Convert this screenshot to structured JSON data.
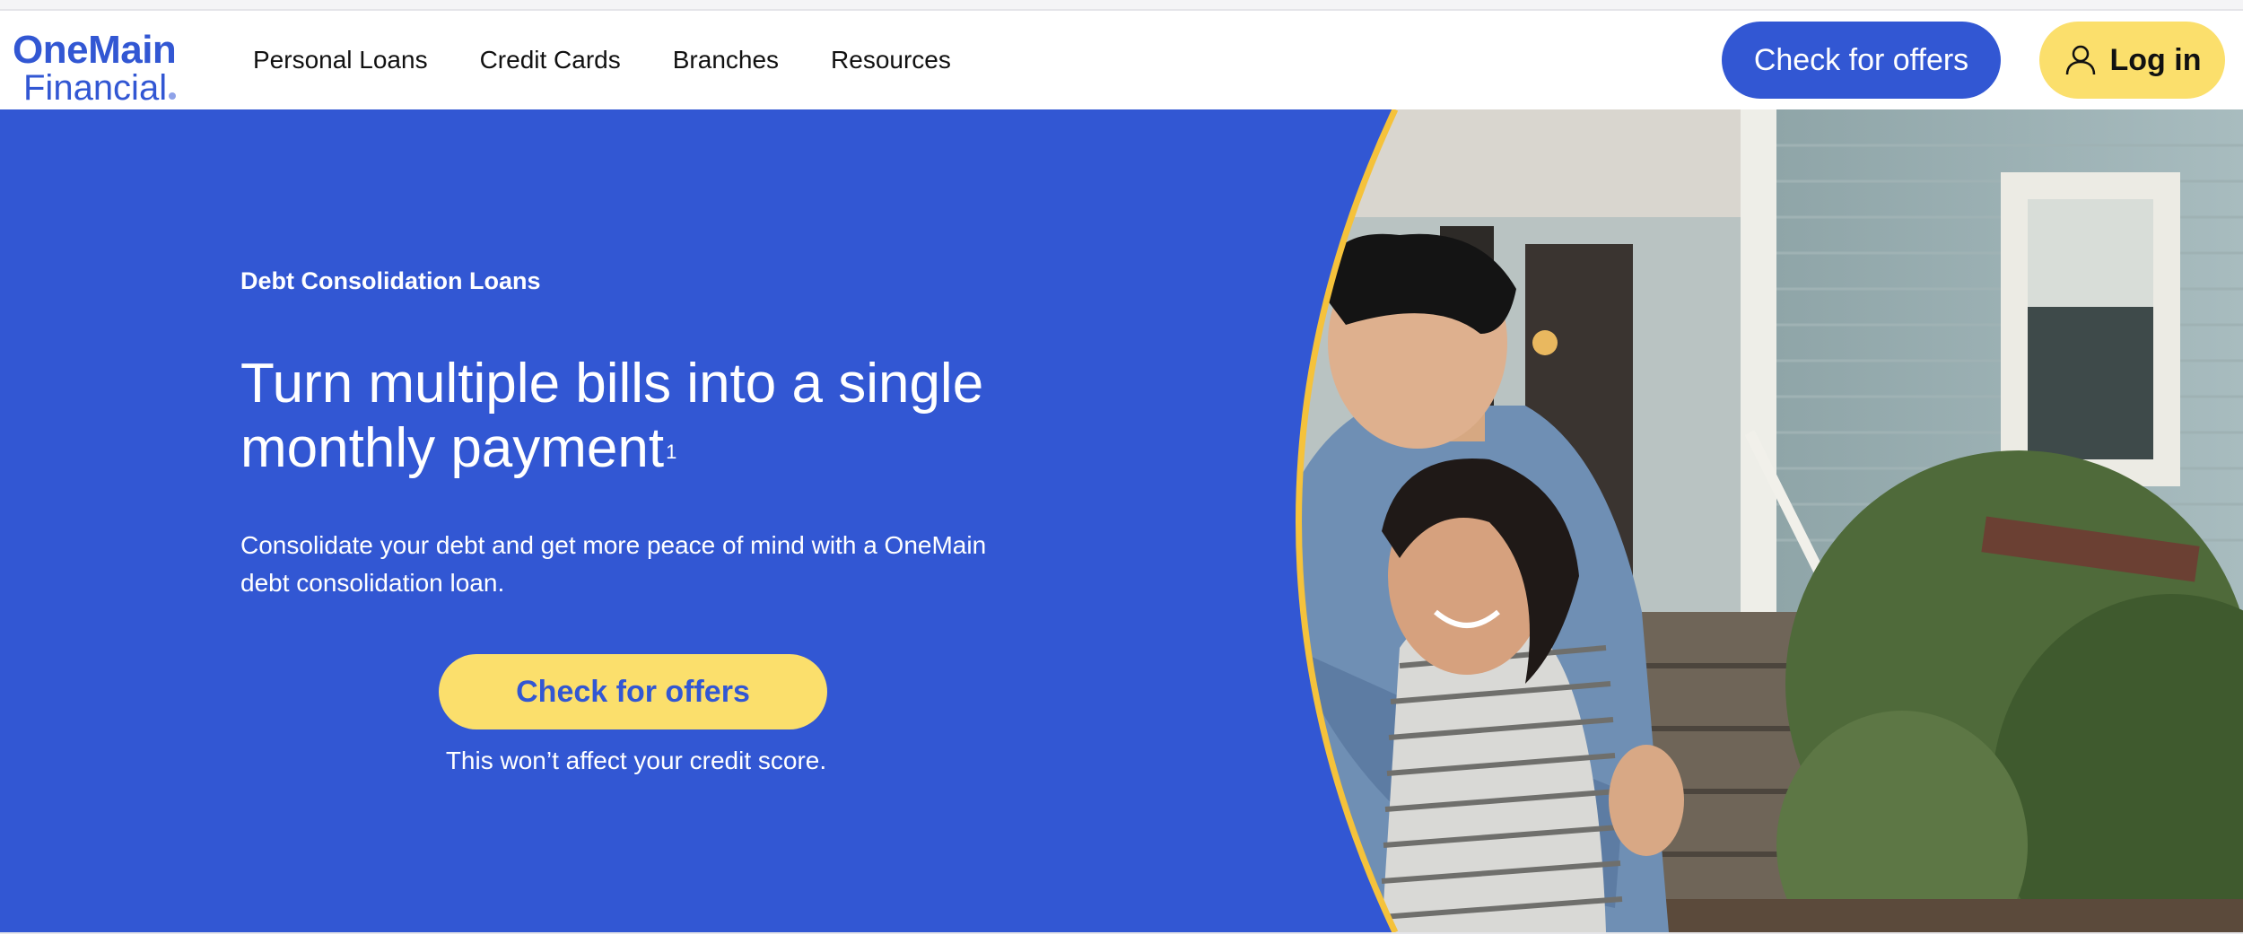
{
  "logo": {
    "line1": "OneMain",
    "line2": "Financial"
  },
  "nav": {
    "items": [
      "Personal Loans",
      "Credit Cards",
      "Branches",
      "Resources"
    ]
  },
  "header": {
    "check_offers_label": "Check for offers",
    "login_label": "Log in"
  },
  "hero": {
    "eyebrow": "Debt Consolidation Loans",
    "title": "Turn multiple bills into a single monthly payment",
    "footnote": "1",
    "description": "Consolidate your debt and get more peace of mind with a OneMain debt consolidation loan.",
    "cta_label": "Check for offers",
    "disclaimer": "This won’t affect your credit score."
  },
  "colors": {
    "brand_blue": "#3257d3",
    "accent_yellow": "#fbdf6c",
    "arc_yellow": "#f5c23b"
  },
  "icons": {
    "login": "user-icon"
  }
}
